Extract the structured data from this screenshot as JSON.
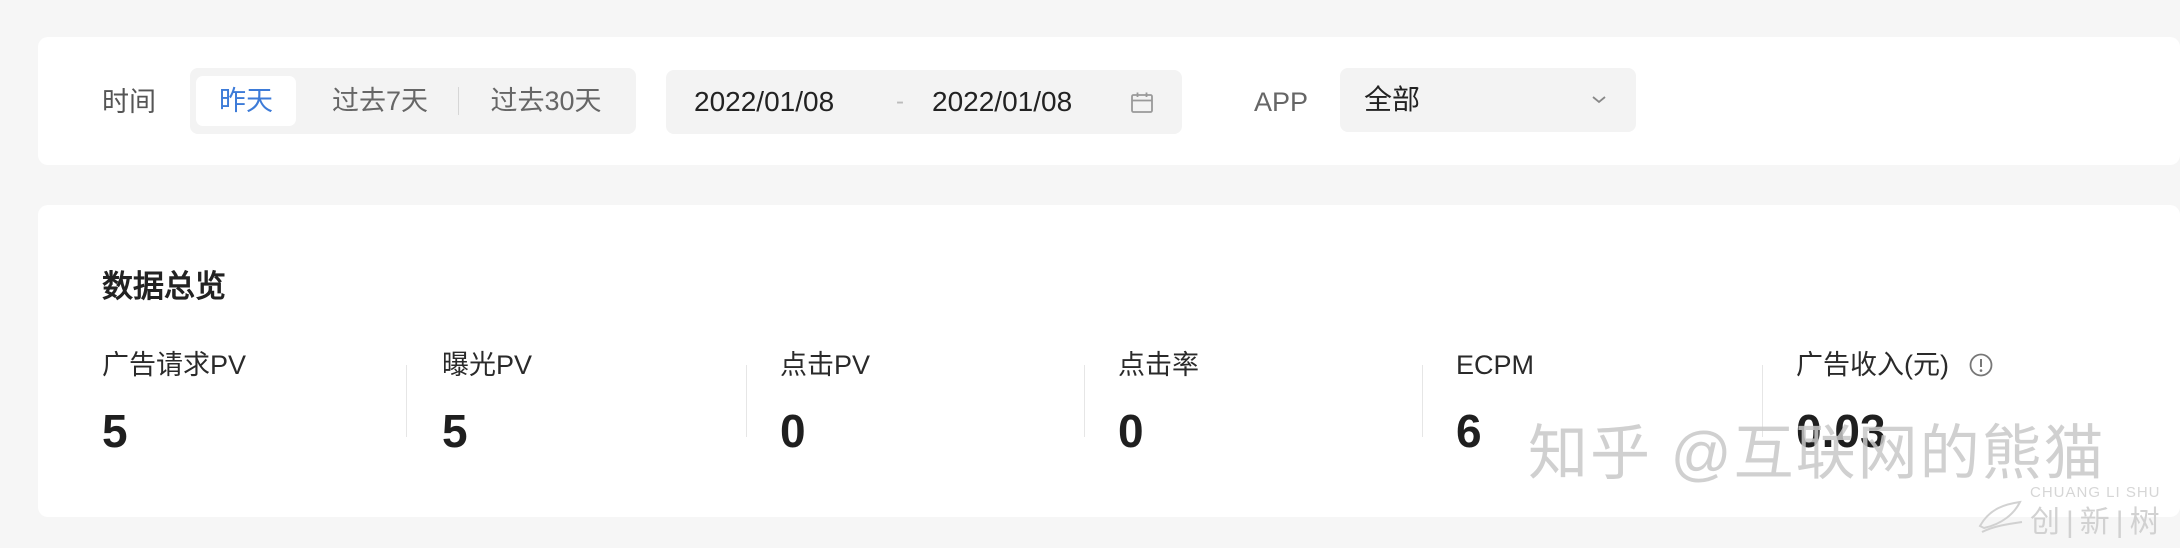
{
  "filters": {
    "time_label": "时间",
    "range_tabs": [
      {
        "label": "昨天",
        "active": true
      },
      {
        "label": "过去7天",
        "active": false
      },
      {
        "label": "过去30天",
        "active": false
      }
    ],
    "start_date": "2022/01/08",
    "range_separator": "-",
    "end_date": "2022/01/08",
    "calendar_icon": "calendar-icon",
    "app_label": "APP",
    "app_selected": "全部",
    "app_dropdown_icon": "chevron-down-icon"
  },
  "overview": {
    "title": "数据总览",
    "metrics": [
      {
        "label": "广告请求PV",
        "value": "5"
      },
      {
        "label": "曝光PV",
        "value": "5"
      },
      {
        "label": "点击PV",
        "value": "0"
      },
      {
        "label": "点击率",
        "value": "0"
      },
      {
        "label": "ECPM",
        "value": "6"
      },
      {
        "label": "广告收入(元)",
        "value": "0.03",
        "info_icon": "info-icon"
      }
    ]
  },
  "watermark": {
    "text": "知乎 @互联网的熊猫",
    "logo_pinyin": "CHUANG LI SHU",
    "logo_chinese": "创|新|树"
  },
  "colors": {
    "accent": "#3d7bd8",
    "page_background": "#f6f6f6",
    "panel_background": "#ffffff",
    "control_background": "#f3f3f3"
  }
}
